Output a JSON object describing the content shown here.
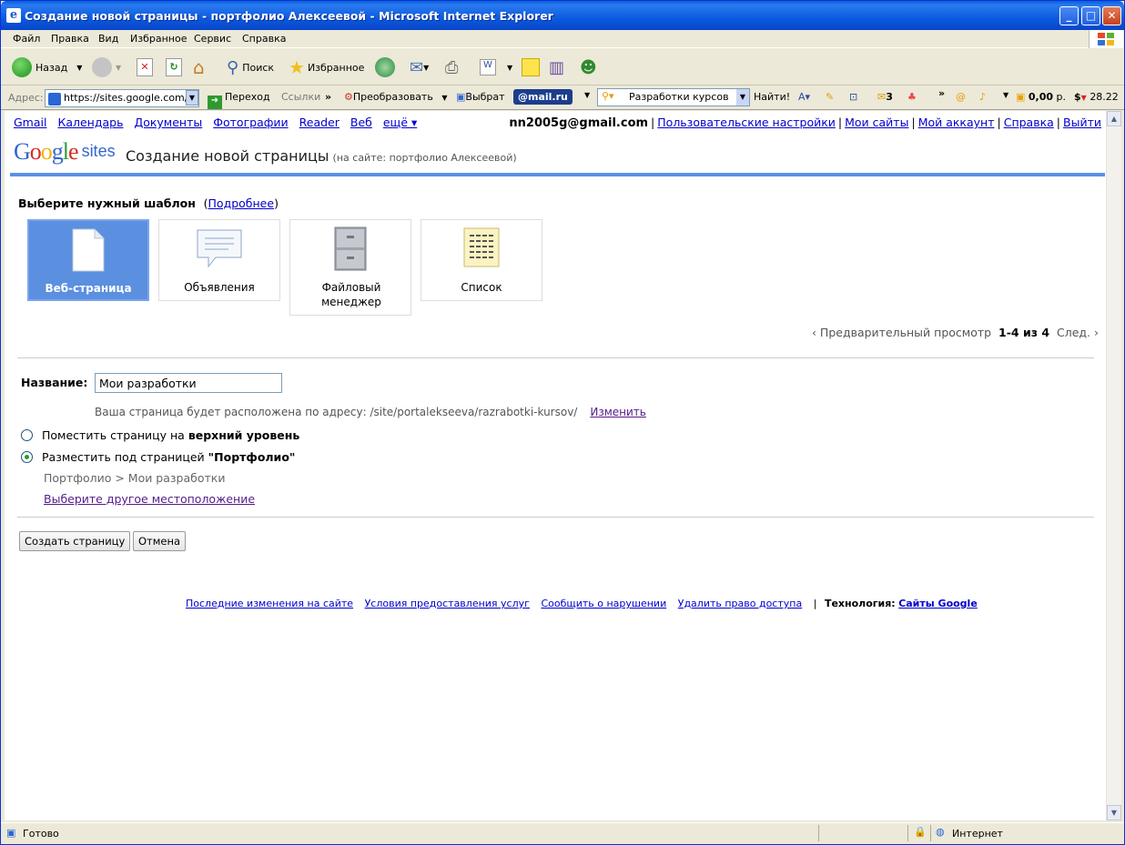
{
  "window": {
    "title": "Создание новой страницы - портфолио Алексеевой - Microsoft Internet Explorer",
    "minimize": "_",
    "maximize": "□",
    "close": "✕"
  },
  "menu": [
    "Файл",
    "Правка",
    "Вид",
    "Избранное",
    "Сервис",
    "Справка"
  ],
  "toolbar": {
    "back": "Назад",
    "search": "Поиск",
    "favorites": "Избранное"
  },
  "addressbar": {
    "label": "Адрес:",
    "url": "https://sites.google.com/si",
    "go": "Переход",
    "links": "Ссылки",
    "convert": "Преобразовать",
    "select": "Выбрат",
    "mailru": "@mail.ru",
    "search_value": "Разработки курсов",
    "find": "Найти!",
    "mail_count": "3",
    "money": "0,00",
    "money_unit": "р.",
    "rate": "28.22"
  },
  "gbar": {
    "links": [
      "Gmail",
      "Календарь",
      "Документы",
      "Фотографии",
      "Reader",
      "Веб",
      "ещё ▾"
    ],
    "email": "nn2005g@gmail.com",
    "right_links": [
      "Пользовательские настройки",
      "Мои сайты",
      "Мой аккаунт",
      "Справка",
      "Выйти"
    ]
  },
  "header": {
    "logo_google": "Google",
    "logo_sites": "sites",
    "title": "Создание новой страницы",
    "subtitle": "(на сайте: портфолио Алексеевой)"
  },
  "templates": {
    "heading": "Выберите нужный шаблон",
    "more_open": "(",
    "more": "Подробнее",
    "more_close": ")",
    "items": [
      "Веб-страница",
      "Объявления",
      "Файловый менеджер",
      "Список"
    ],
    "selected": 0
  },
  "pager": {
    "prev": "‹ Предварительный просмотр",
    "range": "1-4 из 4",
    "next": "След. ›"
  },
  "form": {
    "name_label": "Название:",
    "name_value": "Мои разработки",
    "url_text": "Ваша страница будет расположена по адресу:  /site/portalekseeva/razrabotki-kursov/",
    "url_change": "Изменить",
    "radio1_pre": "Поместить страницу на ",
    "radio1_bold": "верхний уровень",
    "radio2_pre": "Разместить под страницей ",
    "radio2_bold": "\"Портфолио\"",
    "path": "Портфолио > Мои разработки",
    "choose_location": "Выберите другое местоположение",
    "create": "Создать страницу",
    "cancel": "Отмена"
  },
  "footer": {
    "links": [
      "Последние изменения на сайте",
      "Условия предоставления услуг",
      "Сообщить о нарушении",
      "Удалить право доступа"
    ],
    "sep": "|",
    "tech": "Технология:",
    "tech_link": "Сайты Google"
  },
  "status": {
    "text": "Готово",
    "zone": "Интернет"
  }
}
